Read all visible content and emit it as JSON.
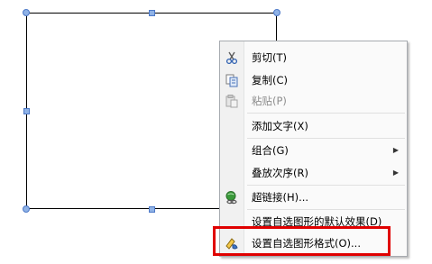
{
  "menu": {
    "items": [
      {
        "label": "剪切(T)",
        "icon": "scissors-icon",
        "enabled": true
      },
      {
        "label": "复制(C)",
        "icon": "copy-icon",
        "enabled": true
      },
      {
        "label": "粘贴(P)",
        "icon": "paste-icon",
        "enabled": false
      },
      {
        "label": "添加文字(X)",
        "icon": "",
        "enabled": true
      },
      {
        "label": "组合(G)",
        "icon": "",
        "enabled": true,
        "submenu": true
      },
      {
        "label": "叠放次序(R)",
        "icon": "",
        "enabled": true,
        "submenu": true
      },
      {
        "label": "超链接(H)...",
        "icon": "hyperlink-globe-icon",
        "enabled": true
      },
      {
        "label": "设置自选图形的默认效果(D)",
        "icon": "",
        "enabled": true
      },
      {
        "label": "设置自选图形格式(O)...",
        "icon": "format-autoshape-icon",
        "enabled": true
      }
    ],
    "submenu_arrow": "▶"
  },
  "colors": {
    "highlight": "#e00000",
    "handle_fill": "#8fb2e6",
    "handle_border": "#4d79c8"
  }
}
